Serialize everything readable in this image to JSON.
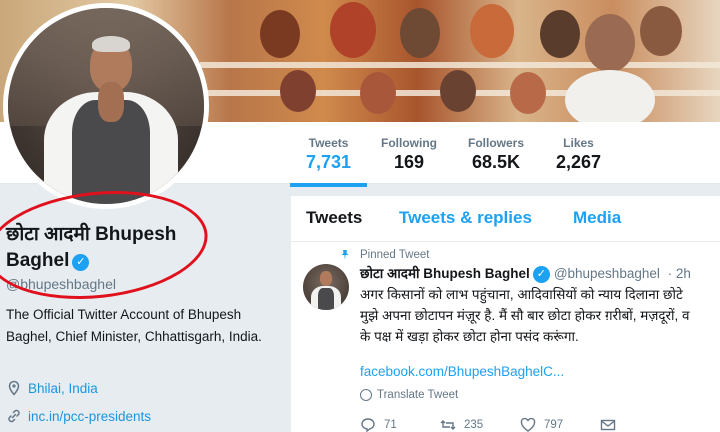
{
  "nav": {
    "tweets": {
      "label": "Tweets",
      "value": "7,731"
    },
    "following": {
      "label": "Following",
      "value": "169"
    },
    "followers": {
      "label": "Followers",
      "value": "68.5K"
    },
    "likes": {
      "label": "Likes",
      "value": "2,267"
    }
  },
  "profile": {
    "name_line1": "छोटा आदमी Bhupesh",
    "name_line2": "Baghel",
    "handle": "@bhupeshbaghel",
    "bio": "The Official Twitter Account of Bhupesh Baghel, Chief Minister, Chhattisgarh, India.",
    "location": "Bhilai, India",
    "website": "inc.in/pcc-presidents"
  },
  "tabs": {
    "tweets": "Tweets",
    "replies": "Tweets & replies",
    "media": "Media"
  },
  "tweet": {
    "pinned_label": "Pinned Tweet",
    "author_name": "छोटा आदमी Bhupesh Baghel",
    "author_handle": "@bhupeshbaghel",
    "time": "· 2h",
    "line1": "अगर किसानों को लाभ पहुंचाना, आदिवासियों को न्याय दिलाना छोटे",
    "line2": "मुझे अपना छोटापन मंज़ूर है. मैं सौ बार छोटा होकर ग़रीबों, मज़दूरों, व",
    "line3": "के पक्ष में खड़ा होकर छोटा होना पसंद करूंगा.",
    "link": "facebook.com/BhupeshBaghelC...",
    "translate": "Translate Tweet",
    "replies_count": "71",
    "retweets_count": "235",
    "likes_count": "797"
  },
  "colors": {
    "accent": "#1da1f2",
    "highlight_circle": "#e0101c"
  }
}
